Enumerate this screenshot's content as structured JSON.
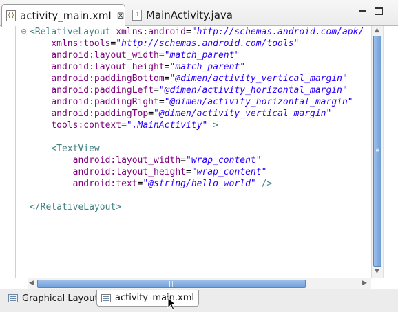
{
  "tabs": [
    {
      "label": "activity_main.xml",
      "active": true,
      "icon": "xml-file-icon"
    },
    {
      "label": "MainActivity.java",
      "active": false,
      "icon": "java-file-icon"
    }
  ],
  "close_glyph": "⊠",
  "fold_glyph": "⊖",
  "code": {
    "relative_open": "<RelativeLayout",
    "xmlns_android_attr": "xmlns:android",
    "xmlns_android_val": "\"http://schemas.android.com/apk/",
    "xmlns_tools_attr": "xmlns:tools",
    "xmlns_tools_val": "\"http://schemas.android.com/tools\"",
    "lw_attr": "android:layout_width",
    "lw_val": "\"match_parent\"",
    "lh_attr": "android:layout_height",
    "lh_val": "\"match_parent\"",
    "pb_attr": "android:paddingBottom",
    "pb_val": "\"@dimen/activity_vertical_margin\"",
    "pl_attr": "android:paddingLeft",
    "pl_val": "\"@dimen/activity_horizontal_margin\"",
    "pr_attr": "android:paddingRight",
    "pr_val": "\"@dimen/activity_horizontal_margin\"",
    "pt_attr": "android:paddingTop",
    "pt_val": "\"@dimen/activity_vertical_margin\"",
    "ctx_attr": "tools:context",
    "ctx_val": "\".MainActivity\"",
    "gt": ">",
    "textview_open": "<TextView",
    "tv_lw_attr": "android:layout_width",
    "tv_lw_val": "\"wrap_content\"",
    "tv_lh_attr": "android:layout_height",
    "tv_lh_val": "\"wrap_content\"",
    "tv_text_attr": "android:text",
    "tv_text_val": "\"@string/hello_world\"",
    "self_close": "/>",
    "relative_close": "</RelativeLayout>",
    "eq": "="
  },
  "bottom_tabs": [
    {
      "label": "Graphical Layout",
      "active": false
    },
    {
      "label": "activity_main.xml",
      "active": true
    }
  ],
  "scroll_arrows": {
    "up": "▲",
    "down": "▼",
    "left": "◀",
    "right": "▶"
  },
  "grip_v": "≡",
  "grip_h": "|||"
}
